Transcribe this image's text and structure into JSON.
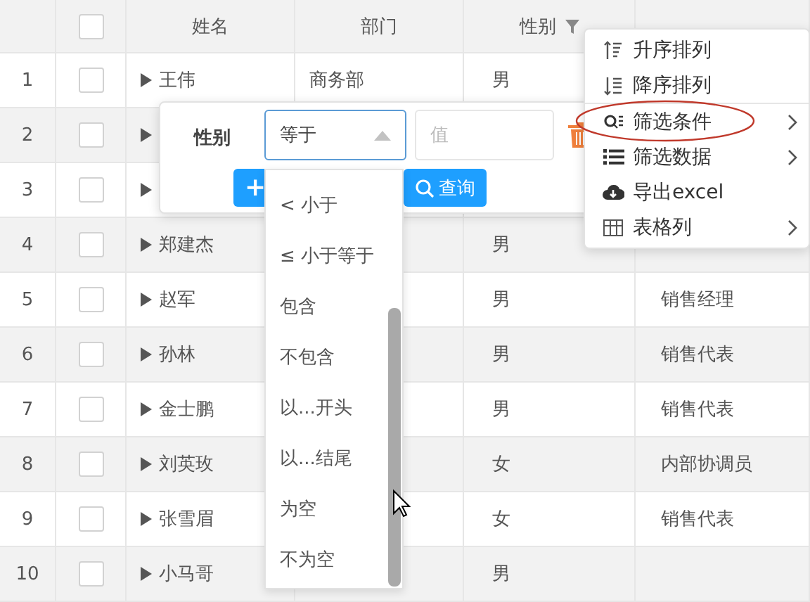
{
  "table": {
    "header": {
      "checked": false,
      "columns": [
        {
          "label": "姓名",
          "filter": false
        },
        {
          "label": "部门",
          "filter": false
        },
        {
          "label": "性别",
          "filter": true
        }
      ]
    },
    "rows": [
      {
        "index": "1",
        "checked": false,
        "expanded": false,
        "name": "王伟",
        "dept": "商务部",
        "gender": "男"
      },
      {
        "index": "2",
        "checked": false,
        "expanded": false
      },
      {
        "index": "3",
        "checked": false,
        "expanded": false
      },
      {
        "index": "4",
        "checked": false,
        "expanded": false,
        "name": "郑建杰",
        "gender": "男"
      },
      {
        "index": "5",
        "checked": false,
        "expanded": false,
        "name": "赵军",
        "gender": "男",
        "position": "销售经理"
      },
      {
        "index": "6",
        "checked": false,
        "expanded": false,
        "name": "孙林",
        "gender": "男",
        "position": "销售代表"
      },
      {
        "index": "7",
        "checked": false,
        "expanded": false,
        "name": "金士鹏",
        "gender": "男",
        "position": "销售代表"
      },
      {
        "index": "8",
        "checked": false,
        "expanded": false,
        "name": "刘英玫",
        "gender": "女",
        "position": "内部协调员"
      },
      {
        "index": "9",
        "checked": false,
        "expanded": false,
        "name": "张雪眉",
        "gender": "女",
        "position": "销售代表"
      },
      {
        "index": "10",
        "checked": false,
        "expanded": false,
        "name": "小马哥",
        "gender": "男"
      }
    ]
  },
  "filter_popup": {
    "field_label": "性别",
    "operator": "等于",
    "value_placeholder": "值",
    "add_button": "+",
    "search_button": "查询"
  },
  "operator_dropdown": {
    "options": [
      "< 小于",
      "≤ 小于等于",
      "包含",
      "不包含",
      "以...开头",
      "以...结尾",
      "为空",
      "不为空"
    ]
  },
  "context_menu": {
    "items": [
      {
        "label": "升序排列",
        "submenu": false,
        "separator": false,
        "circled": false
      },
      {
        "label": "降序排列",
        "submenu": false,
        "separator": false,
        "circled": false
      },
      {
        "label": "筛选条件",
        "submenu": true,
        "separator": true,
        "circled": true
      },
      {
        "label": "筛选数据",
        "submenu": true,
        "separator": false,
        "circled": false
      },
      {
        "label": "导出excel",
        "submenu": false,
        "separator": false,
        "circled": false
      },
      {
        "label": "表格列",
        "submenu": true,
        "separator": false,
        "circled": false
      }
    ]
  }
}
